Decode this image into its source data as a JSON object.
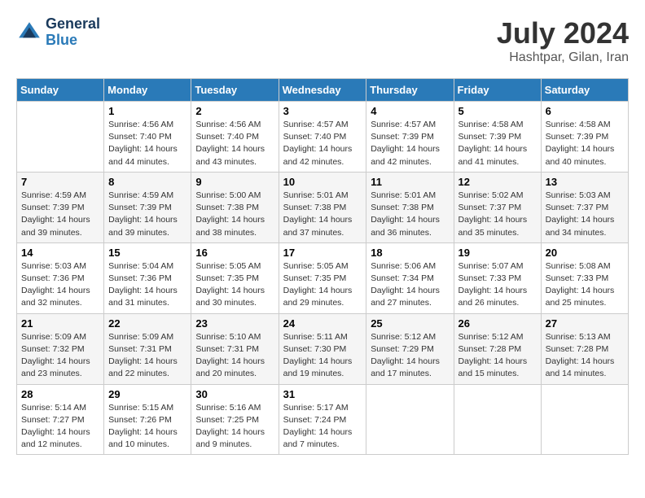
{
  "header": {
    "logo_line1": "General",
    "logo_line2": "Blue",
    "month_title": "July 2024",
    "location": "Hashtpar, Gilan, Iran"
  },
  "columns": [
    "Sunday",
    "Monday",
    "Tuesday",
    "Wednesday",
    "Thursday",
    "Friday",
    "Saturday"
  ],
  "weeks": [
    {
      "shaded": false,
      "days": [
        {
          "num": "",
          "text": ""
        },
        {
          "num": "1",
          "text": "Sunrise: 4:56 AM\nSunset: 7:40 PM\nDaylight: 14 hours\nand 44 minutes."
        },
        {
          "num": "2",
          "text": "Sunrise: 4:56 AM\nSunset: 7:40 PM\nDaylight: 14 hours\nand 43 minutes."
        },
        {
          "num": "3",
          "text": "Sunrise: 4:57 AM\nSunset: 7:40 PM\nDaylight: 14 hours\nand 42 minutes."
        },
        {
          "num": "4",
          "text": "Sunrise: 4:57 AM\nSunset: 7:39 PM\nDaylight: 14 hours\nand 42 minutes."
        },
        {
          "num": "5",
          "text": "Sunrise: 4:58 AM\nSunset: 7:39 PM\nDaylight: 14 hours\nand 41 minutes."
        },
        {
          "num": "6",
          "text": "Sunrise: 4:58 AM\nSunset: 7:39 PM\nDaylight: 14 hours\nand 40 minutes."
        }
      ]
    },
    {
      "shaded": true,
      "days": [
        {
          "num": "7",
          "text": "Sunrise: 4:59 AM\nSunset: 7:39 PM\nDaylight: 14 hours\nand 39 minutes."
        },
        {
          "num": "8",
          "text": "Sunrise: 4:59 AM\nSunset: 7:39 PM\nDaylight: 14 hours\nand 39 minutes."
        },
        {
          "num": "9",
          "text": "Sunrise: 5:00 AM\nSunset: 7:38 PM\nDaylight: 14 hours\nand 38 minutes."
        },
        {
          "num": "10",
          "text": "Sunrise: 5:01 AM\nSunset: 7:38 PM\nDaylight: 14 hours\nand 37 minutes."
        },
        {
          "num": "11",
          "text": "Sunrise: 5:01 AM\nSunset: 7:38 PM\nDaylight: 14 hours\nand 36 minutes."
        },
        {
          "num": "12",
          "text": "Sunrise: 5:02 AM\nSunset: 7:37 PM\nDaylight: 14 hours\nand 35 minutes."
        },
        {
          "num": "13",
          "text": "Sunrise: 5:03 AM\nSunset: 7:37 PM\nDaylight: 14 hours\nand 34 minutes."
        }
      ]
    },
    {
      "shaded": false,
      "days": [
        {
          "num": "14",
          "text": "Sunrise: 5:03 AM\nSunset: 7:36 PM\nDaylight: 14 hours\nand 32 minutes."
        },
        {
          "num": "15",
          "text": "Sunrise: 5:04 AM\nSunset: 7:36 PM\nDaylight: 14 hours\nand 31 minutes."
        },
        {
          "num": "16",
          "text": "Sunrise: 5:05 AM\nSunset: 7:35 PM\nDaylight: 14 hours\nand 30 minutes."
        },
        {
          "num": "17",
          "text": "Sunrise: 5:05 AM\nSunset: 7:35 PM\nDaylight: 14 hours\nand 29 minutes."
        },
        {
          "num": "18",
          "text": "Sunrise: 5:06 AM\nSunset: 7:34 PM\nDaylight: 14 hours\nand 27 minutes."
        },
        {
          "num": "19",
          "text": "Sunrise: 5:07 AM\nSunset: 7:33 PM\nDaylight: 14 hours\nand 26 minutes."
        },
        {
          "num": "20",
          "text": "Sunrise: 5:08 AM\nSunset: 7:33 PM\nDaylight: 14 hours\nand 25 minutes."
        }
      ]
    },
    {
      "shaded": true,
      "days": [
        {
          "num": "21",
          "text": "Sunrise: 5:09 AM\nSunset: 7:32 PM\nDaylight: 14 hours\nand 23 minutes."
        },
        {
          "num": "22",
          "text": "Sunrise: 5:09 AM\nSunset: 7:31 PM\nDaylight: 14 hours\nand 22 minutes."
        },
        {
          "num": "23",
          "text": "Sunrise: 5:10 AM\nSunset: 7:31 PM\nDaylight: 14 hours\nand 20 minutes."
        },
        {
          "num": "24",
          "text": "Sunrise: 5:11 AM\nSunset: 7:30 PM\nDaylight: 14 hours\nand 19 minutes."
        },
        {
          "num": "25",
          "text": "Sunrise: 5:12 AM\nSunset: 7:29 PM\nDaylight: 14 hours\nand 17 minutes."
        },
        {
          "num": "26",
          "text": "Sunrise: 5:12 AM\nSunset: 7:28 PM\nDaylight: 14 hours\nand 15 minutes."
        },
        {
          "num": "27",
          "text": "Sunrise: 5:13 AM\nSunset: 7:28 PM\nDaylight: 14 hours\nand 14 minutes."
        }
      ]
    },
    {
      "shaded": false,
      "days": [
        {
          "num": "28",
          "text": "Sunrise: 5:14 AM\nSunset: 7:27 PM\nDaylight: 14 hours\nand 12 minutes."
        },
        {
          "num": "29",
          "text": "Sunrise: 5:15 AM\nSunset: 7:26 PM\nDaylight: 14 hours\nand 10 minutes."
        },
        {
          "num": "30",
          "text": "Sunrise: 5:16 AM\nSunset: 7:25 PM\nDaylight: 14 hours\nand 9 minutes."
        },
        {
          "num": "31",
          "text": "Sunrise: 5:17 AM\nSunset: 7:24 PM\nDaylight: 14 hours\nand 7 minutes."
        },
        {
          "num": "",
          "text": ""
        },
        {
          "num": "",
          "text": ""
        },
        {
          "num": "",
          "text": ""
        }
      ]
    }
  ]
}
